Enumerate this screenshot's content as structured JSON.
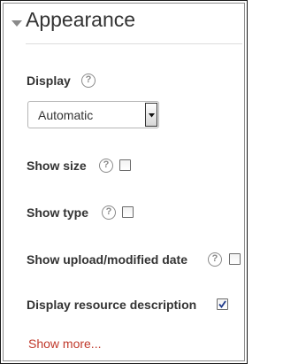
{
  "section": {
    "title": "Appearance",
    "expanded": true
  },
  "display": {
    "label": "Display",
    "selected": "Automatic"
  },
  "options": [
    {
      "label": "Show size",
      "checked": false
    },
    {
      "label": "Show type",
      "checked": false
    },
    {
      "label": "Show upload/modified date",
      "checked": false
    },
    {
      "label": "Display resource description",
      "checked": true
    }
  ],
  "help_icon_glyph": "?",
  "show_more_label": "Show more...",
  "colors": {
    "link": "#c0392b",
    "text": "#333333",
    "help_icon": "#8a8a8a"
  }
}
